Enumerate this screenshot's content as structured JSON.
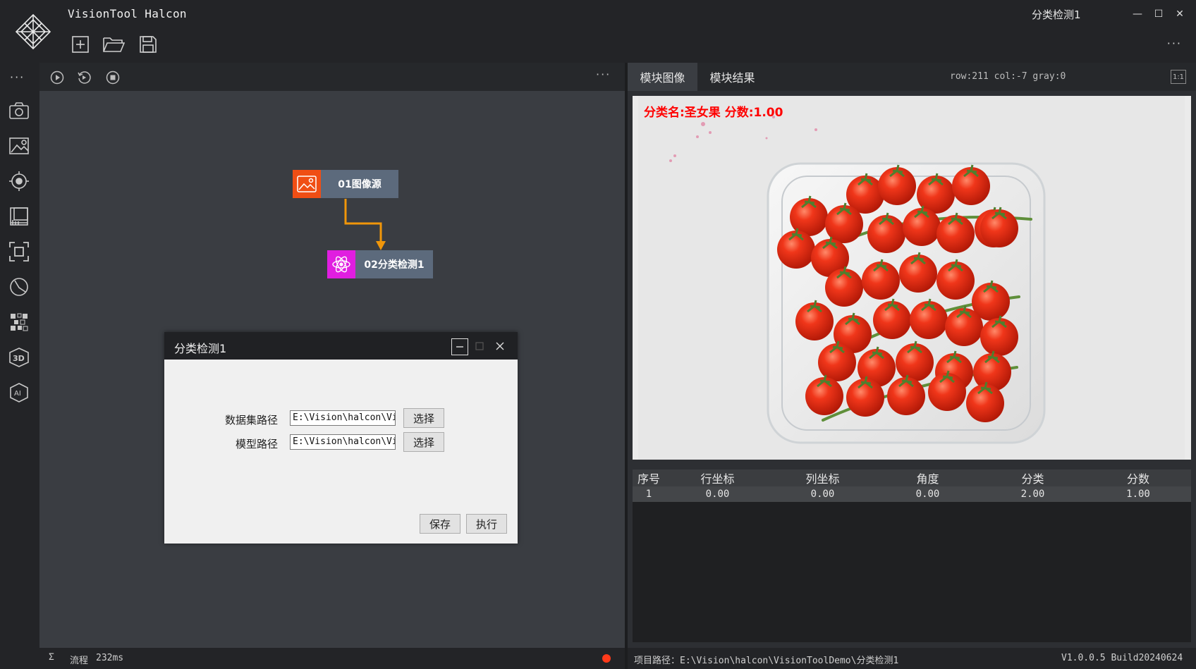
{
  "app": {
    "title": "VisionTool Halcon",
    "window_caption": "分类检测1",
    "titlebar_more": "···",
    "toolbar_icons": [
      "new-file-icon",
      "open-folder-icon",
      "save-icon"
    ]
  },
  "window_controls": {
    "minimize": "—",
    "maximize": "☐",
    "close": "✕"
  },
  "rail": {
    "more": "···",
    "icons": [
      "camera-icon",
      "image-settings-icon",
      "target-icon",
      "calibration-icon",
      "focus-frame-icon",
      "measure-icon",
      "pattern-icon",
      "3d-icon",
      "ai-icon"
    ]
  },
  "flow": {
    "more": "···",
    "controls": [
      "run-icon",
      "loop-run-icon",
      "stop-icon"
    ],
    "nodes": [
      {
        "label": "01图像源",
        "icon": "image-source-icon",
        "color": "#f04e14"
      },
      {
        "label": "02分类检测1",
        "icon": "classify-icon",
        "color": "#e01ee0"
      }
    ],
    "connector_color": "#f0960a"
  },
  "dialog": {
    "title": "分类检测1",
    "dataset_label": "数据集路径",
    "dataset_value": "E:\\Vision\\halcon\\Vi",
    "model_label": "模型路径",
    "model_value": "E:\\Vision\\halcon\\Vi",
    "choose_label": "选择",
    "save_label": "保存",
    "run_label": "执行"
  },
  "right": {
    "tabs": [
      "模块图像",
      "模块结果"
    ],
    "active_tab": 0,
    "pixel_readout": "row:211 col:-7 gray:0",
    "zoom_label": "1:1",
    "image_overlay": "分类名:圣女果 分数:1.00",
    "image_subject": "cherry-tomatoes-in-plastic-tray",
    "table": {
      "headers": [
        "序号",
        "行坐标",
        "列坐标",
        "角度",
        "分类",
        "分数"
      ],
      "rows": [
        [
          "1",
          "0.00",
          "0.00",
          "0.00",
          "2.00",
          "1.00"
        ]
      ]
    }
  },
  "status": {
    "sigma": "Σ",
    "flow_label": "流程",
    "flow_time": "232ms",
    "project_path": "项目路径：E:\\Vision\\halcon\\VisionToolDemo\\分类检测1",
    "version": "V1.0.0.5 Build20240624",
    "indicator_color": "#ff3a1a"
  }
}
